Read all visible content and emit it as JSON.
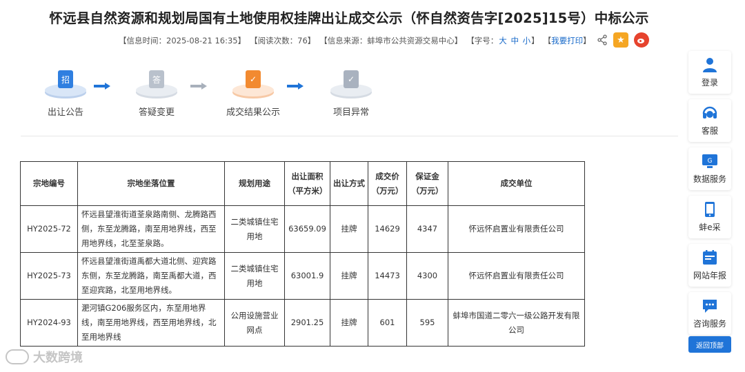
{
  "page": {
    "title": "怀远县自然资源和规划局国有土地使用权挂牌出让成交公示（怀自然资告字[2025]15号）中标公示"
  },
  "meta": {
    "info_time": "【信息时间：2025-08-21 16:35】",
    "read_count": "【阅读次数：76】",
    "source_prefix": "【信息来源：",
    "source": "蚌埠市公共资源交易中心",
    "source_suffix": "】",
    "font_prefix": "【字号：",
    "font_large": "大",
    "font_medium": "中",
    "font_small": "小",
    "font_suffix": "】",
    "print_prefix": "【",
    "print": "我要打印",
    "print_suffix": "】"
  },
  "steps": [
    {
      "label": "出让公告",
      "icon": "announcement-icon",
      "glyph": "招",
      "status": "done"
    },
    {
      "label": "答疑变更",
      "icon": "qa-icon",
      "glyph": "答",
      "status": "inactive"
    },
    {
      "label": "成交结果公示",
      "icon": "result-icon",
      "glyph": "✓",
      "status": "current"
    },
    {
      "label": "项目异常",
      "icon": "exception-icon",
      "glyph": "✓",
      "status": "inactive"
    }
  ],
  "table": {
    "headers": {
      "parcel_no": "宗地编号",
      "location": "宗地坐落位置",
      "use": "规划用途",
      "area": "出让面积（平方米）",
      "method": "出让方式",
      "price": "成交价（万元）",
      "deposit": "保证金（万元）",
      "winner": "成交单位"
    },
    "rows": [
      {
        "parcel_no": "HY2025-72",
        "location": "怀远县望淮街道荃泉路南侧、龙腾路西侧，东至龙腾路，南至用地界线，西至用地界线，北至荃泉路。",
        "use": "二类城镇住宅用地",
        "area": "63659.09",
        "method": "挂牌",
        "price": "14629",
        "deposit": "4347",
        "winner": "怀远怀启置业有限责任公司"
      },
      {
        "parcel_no": "HY2025-73",
        "location": "怀远县望淮街道禹都大道北侧、迎宾路东侧，东至龙腾路，南至禹都大道，西至迎宾路，北至用地界线。",
        "use": "二类城镇住宅用地",
        "area": "63001.9",
        "method": "挂牌",
        "price": "14473",
        "deposit": "4300",
        "winner": "怀远怀启置业有限责任公司"
      },
      {
        "parcel_no": "HY2024-93",
        "location": "淝河镇G206服务区内，东至用地界线，南至用地界线，西至用地界线，北至用地界线",
        "use": "公用设施营业网点",
        "area": "2901.25",
        "method": "挂牌",
        "price": "601",
        "deposit": "595",
        "winner": "蚌埠市国道二零六一级公路开发有限公司"
      }
    ]
  },
  "sidebar": {
    "items": [
      {
        "label": "登录",
        "icon": "user-icon"
      },
      {
        "label": "客服",
        "icon": "headset-icon"
      },
      {
        "label": "数据服务",
        "icon": "data-service-icon"
      },
      {
        "label": "蚌e采",
        "icon": "mobile-icon"
      },
      {
        "label": "网站年报",
        "icon": "annual-report-icon"
      },
      {
        "label": "咨询服务",
        "icon": "chat-icon"
      }
    ],
    "back_top": "返回顶部"
  },
  "watermark": {
    "text": "大数跨境"
  },
  "colors": {
    "accent": "#1769c9",
    "step_done": "#2f7fe0",
    "step_current": "#f28a30",
    "back_top": "#1f74d8"
  }
}
